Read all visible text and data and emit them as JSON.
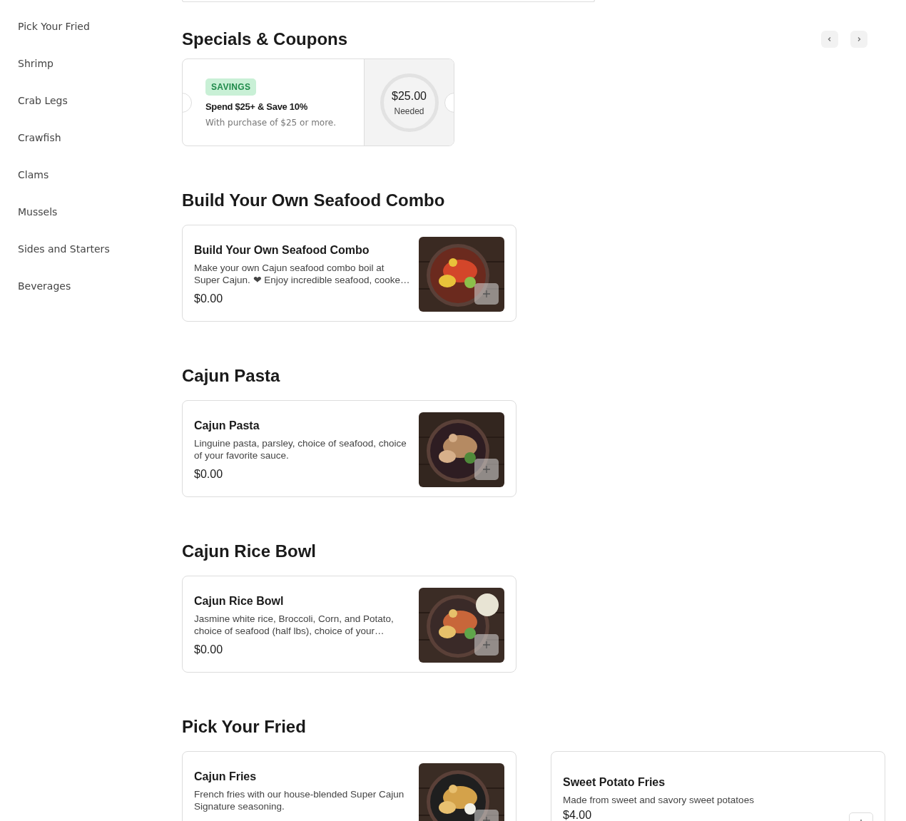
{
  "sidebar": {
    "items": [
      {
        "label": "Pick Your Fried",
        "selected": false
      },
      {
        "label": "Shrimp",
        "selected": false
      },
      {
        "label": "Crab Legs",
        "selected": false
      },
      {
        "label": "Crawfish",
        "selected": false
      },
      {
        "label": "Clams",
        "selected": false
      },
      {
        "label": "Mussels",
        "selected": false
      },
      {
        "label": "Sides and Starters",
        "selected": false
      },
      {
        "label": "Beverages",
        "selected": false
      }
    ]
  },
  "specials": {
    "title": "Specials & Coupons",
    "coupon": {
      "tag": "SAVINGS",
      "title": "Spend $25+ & Save 10%",
      "subtitle": "With purchase of $25 or more.",
      "amount": "$25.00",
      "amount_label": "Needed"
    }
  },
  "sections": [
    {
      "title": "Build Your Own Seafood Combo",
      "items": [
        {
          "name": "Build Your Own Seafood Combo",
          "description": "Make your own Cajun seafood combo boil at Super Cajun. ❤ Enjoy incredible seafood, cooke…",
          "price": "$0.00"
        }
      ]
    },
    {
      "title": "Cajun Pasta",
      "items": [
        {
          "name": "Cajun Pasta",
          "description": "Linguine pasta, parsley, choice of seafood, choice of your favorite sauce.",
          "price": "$0.00"
        }
      ]
    },
    {
      "title": "Cajun Rice Bowl",
      "items": [
        {
          "name": "Cajun Rice Bowl",
          "description": "Jasmine white rice, Broccoli, Corn, and Potato, choice of seafood (half lbs), choice of your…",
          "price": "$0.00"
        }
      ]
    },
    {
      "title": "Pick Your Fried",
      "items": [
        {
          "name": "Cajun Fries",
          "description": "French fries with our house-blended Super Cajun Signature seasoning."
        },
        {
          "name": "Sweet Potato Fries",
          "description": "Made from sweet and savory sweet potatoes",
          "price": "$4.00"
        }
      ]
    }
  ]
}
